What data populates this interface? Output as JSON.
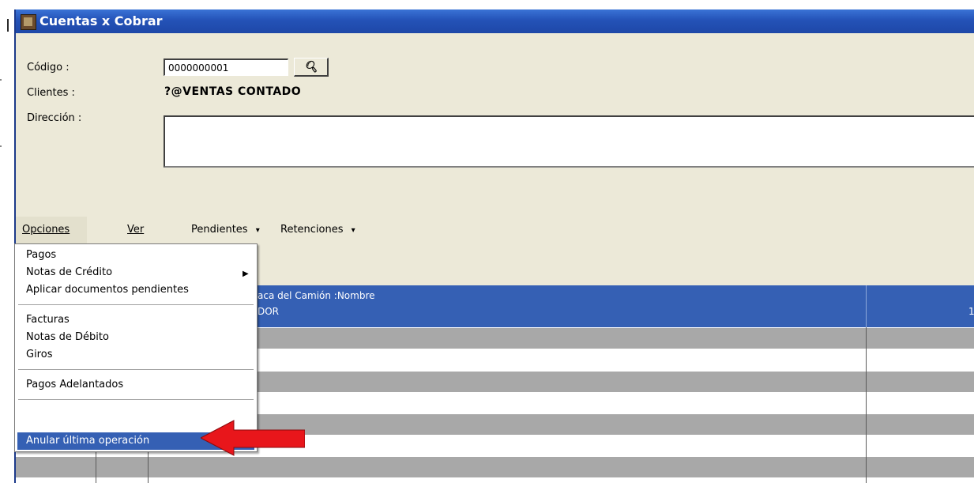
{
  "window": {
    "title": "Cuentas x Cobrar"
  },
  "form": {
    "codigo_label": "Código :",
    "codigo_value": "0000000001",
    "clientes_label": "Clientes :",
    "cliente_value": "?@VENTAS CONTADO",
    "direccion_label": "Dirección :",
    "direccion_value": ""
  },
  "menubar": {
    "opciones": "Opciones",
    "ver": "Ver",
    "pendientes": "Pendientes",
    "retenciones": "Retenciones",
    "dropdown_marker": "▾"
  },
  "grid": {
    "header_line1": "aca del Camión :Nombre",
    "header_line2": "DOR",
    "header_col_right": "1"
  },
  "dropdown": {
    "items": [
      {
        "label": "Pagos"
      },
      {
        "label": "Notas de Crédito",
        "submenu_marker": "▶"
      },
      {
        "label": "Aplicar documentos pendientes"
      },
      {
        "label": "Facturas"
      },
      {
        "label": "Notas de Débito"
      },
      {
        "label": "Giros"
      },
      {
        "label": "Pagos Adelantados"
      },
      {
        "label": "Anular última operación"
      }
    ],
    "selected_index": 7
  },
  "colors": {
    "titlebar": "#2452b7",
    "selection": "#3560b4",
    "grid_gray_row": "#a8a8a8",
    "arrow": "#e8161b"
  }
}
